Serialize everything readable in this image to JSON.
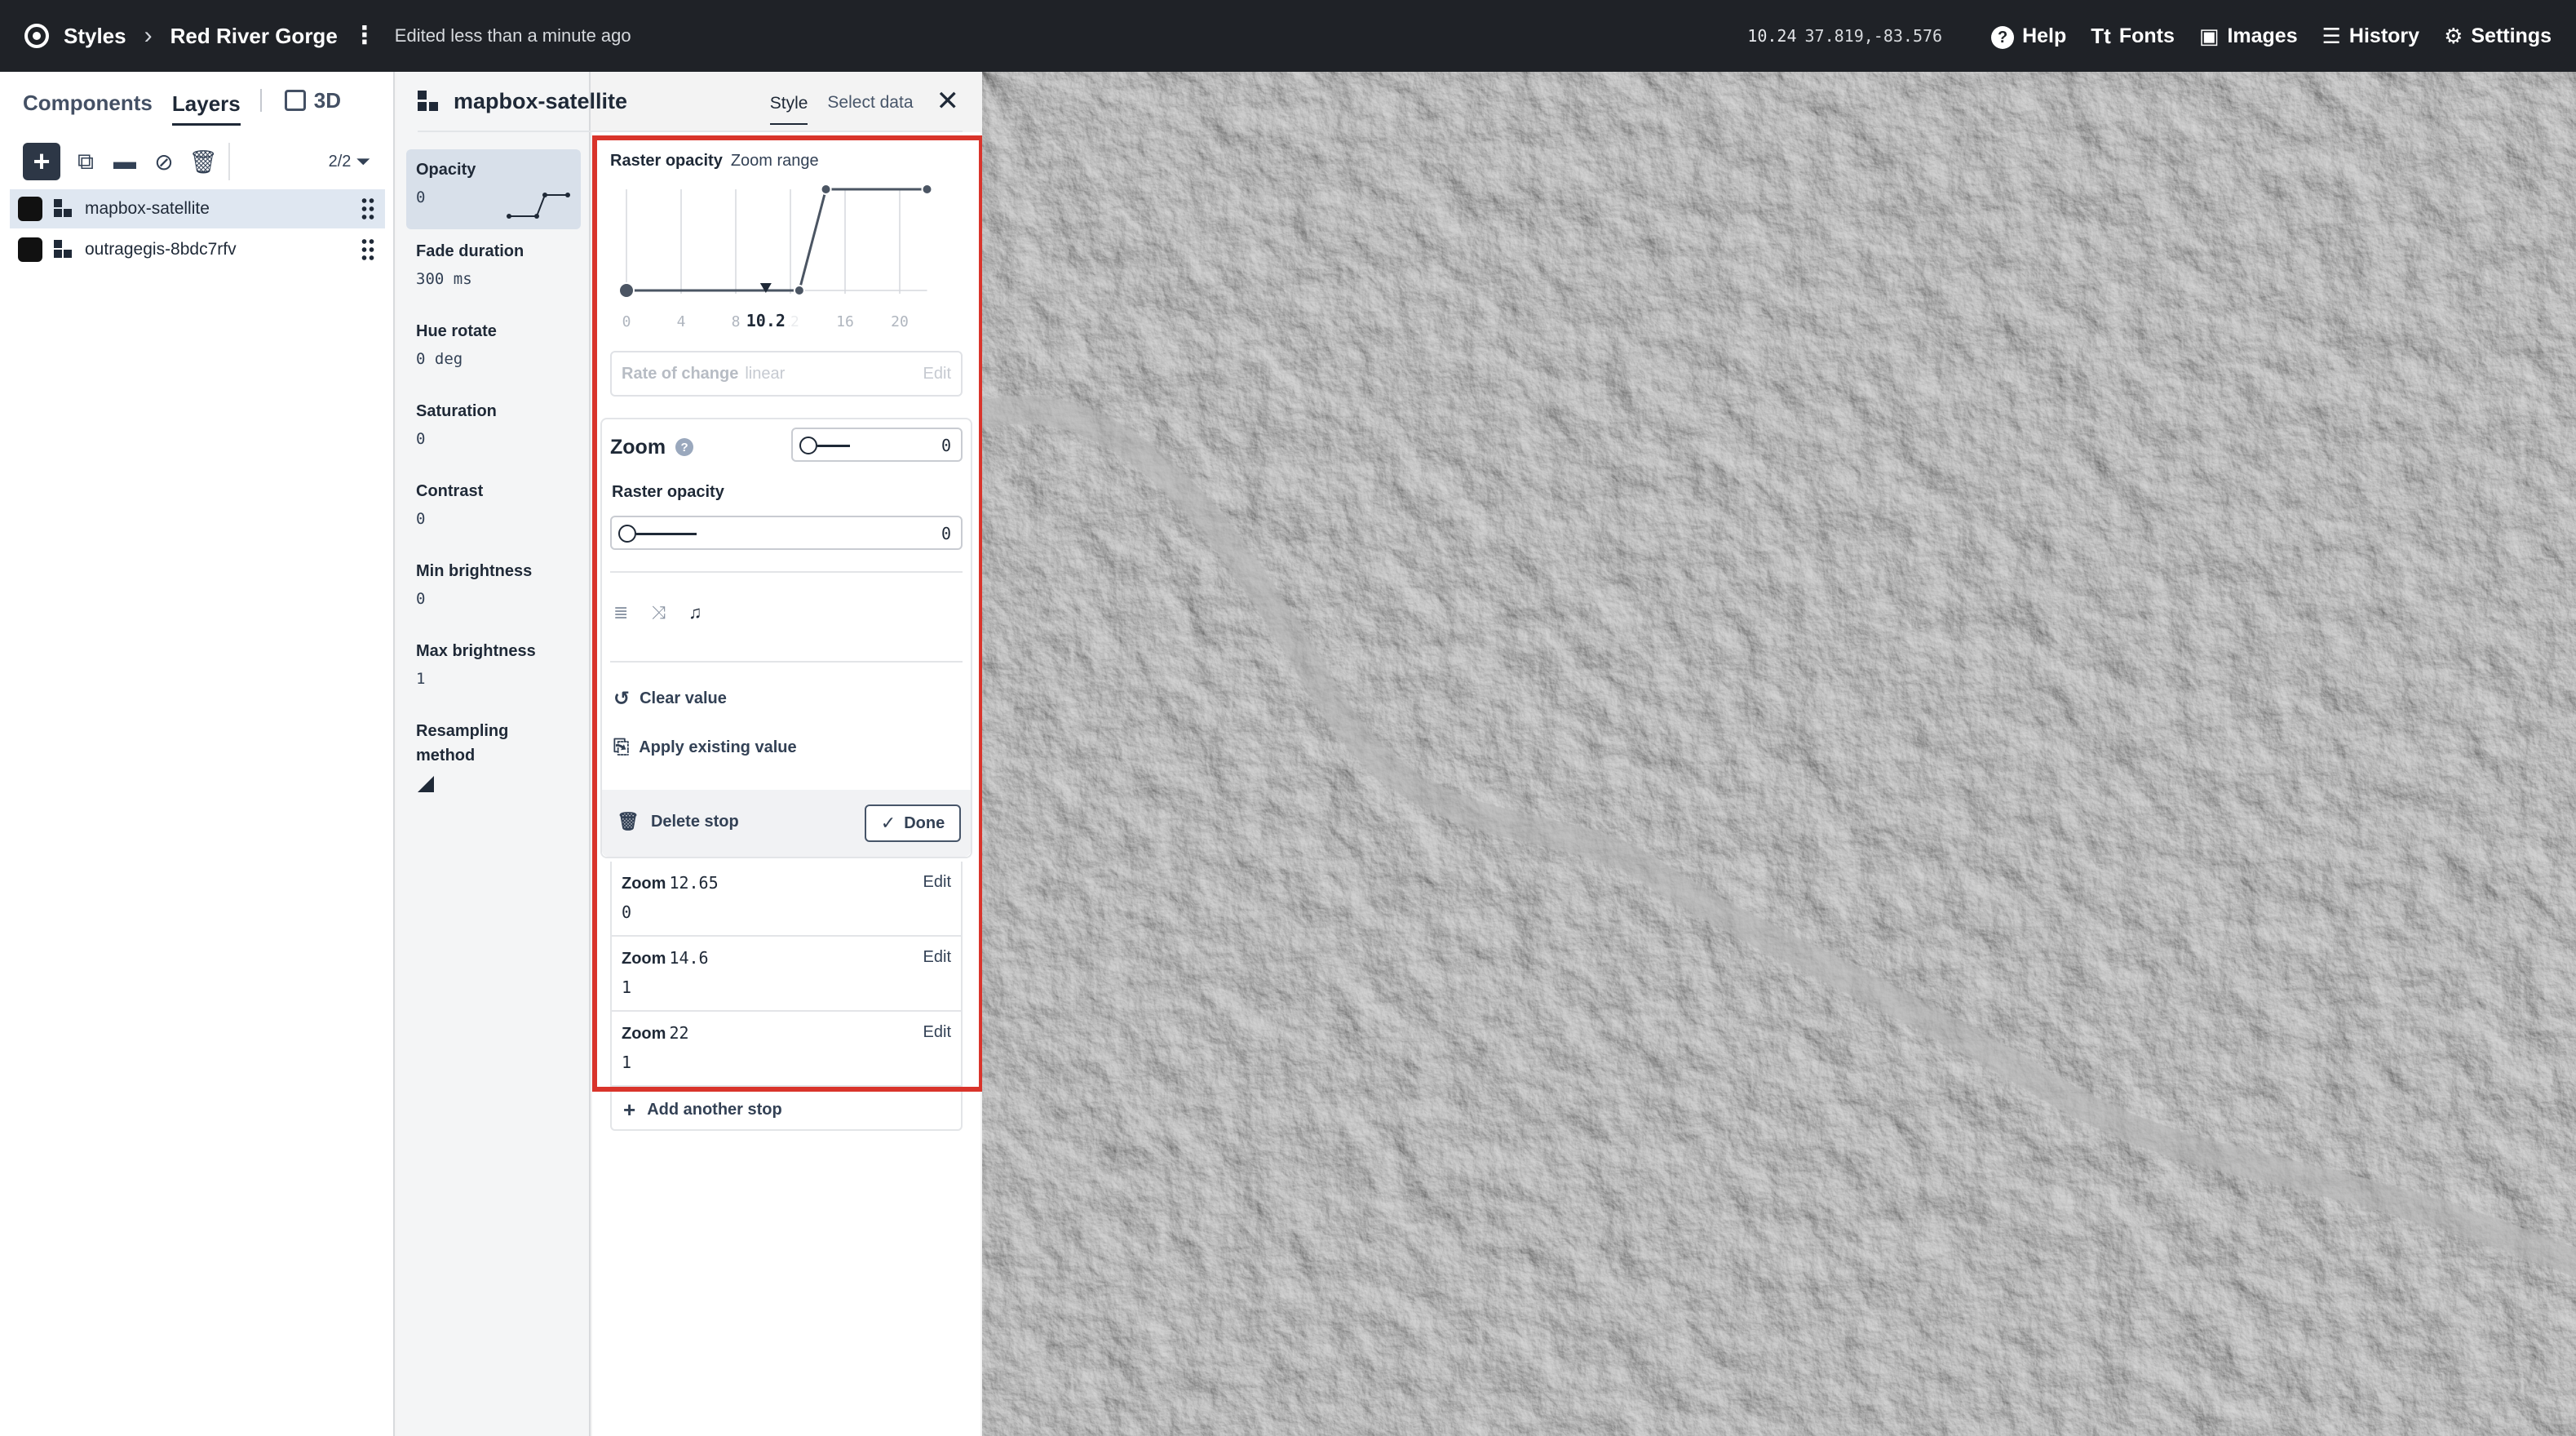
{
  "topbar": {
    "styles_label": "Styles",
    "separator": ">",
    "project_name": "Red River Gorge",
    "edited_status": "Edited less than a minute ago",
    "zoom": "10.24",
    "coords": "37.819,-83.576",
    "help_label": "Help",
    "fonts_label": "Fonts",
    "images_label": "Images",
    "history_label": "History",
    "settings_label": "Settings"
  },
  "left_panel": {
    "tabs": {
      "components": "Components",
      "layers": "Layers",
      "three_d": "3D"
    },
    "layer_count": "2/2",
    "layers": [
      {
        "name": "mapbox-satellite",
        "selected": true
      },
      {
        "name": "outragegis-8bdc7rfv",
        "selected": false
      }
    ]
  },
  "layer_panel": {
    "title": "mapbox-satellite",
    "tabs": {
      "style": "Style",
      "select_data": "Select data"
    },
    "properties": [
      {
        "label": "Opacity",
        "value": "0"
      },
      {
        "label": "Fade duration",
        "value": "300 ms"
      },
      {
        "label": "Hue rotate",
        "value": "0 deg"
      },
      {
        "label": "Saturation",
        "value": "0"
      },
      {
        "label": "Contrast",
        "value": "0"
      },
      {
        "label": "Min brightness",
        "value": "0"
      },
      {
        "label": "Max brightness",
        "value": "1"
      },
      {
        "label": "Resampling method",
        "value": ""
      }
    ]
  },
  "editor": {
    "property_label": "Raster opacity",
    "mode_label": "Zoom range",
    "axis_ticks": [
      "0",
      "4",
      "8",
      "12",
      "16",
      "20"
    ],
    "current_zoom_label": "10.2",
    "stops_chart": [
      {
        "zoom": 0,
        "value": 0
      },
      {
        "zoom": 10.2,
        "value": 0
      },
      {
        "zoom": 12.65,
        "value": 0
      },
      {
        "zoom": 14.6,
        "value": 1
      },
      {
        "zoom": 22,
        "value": 1
      }
    ],
    "rate_label": "Rate of change",
    "rate_value": "linear",
    "rate_edit": "Edit",
    "zoom_label": "Zoom",
    "zoom_value": "0",
    "raster_opacity_label": "Raster opacity",
    "raster_opacity_value": "0",
    "clear_value": "Clear value",
    "apply_existing": "Apply existing value",
    "delete_stop": "Delete stop",
    "done": "Done",
    "stops": [
      {
        "zoom_label": "Zoom",
        "zoom": "12.65",
        "value": "0",
        "edit": "Edit"
      },
      {
        "zoom_label": "Zoom",
        "zoom": "14.6",
        "value": "1",
        "edit": "Edit"
      },
      {
        "zoom_label": "Zoom",
        "zoom": "22",
        "value": "1",
        "edit": "Edit"
      }
    ],
    "add_stop": "Add another stop"
  },
  "colors": {
    "topbar_bg": "#1f2227",
    "highlight": "#d9342b",
    "selected_row": "#dfe7f1"
  }
}
